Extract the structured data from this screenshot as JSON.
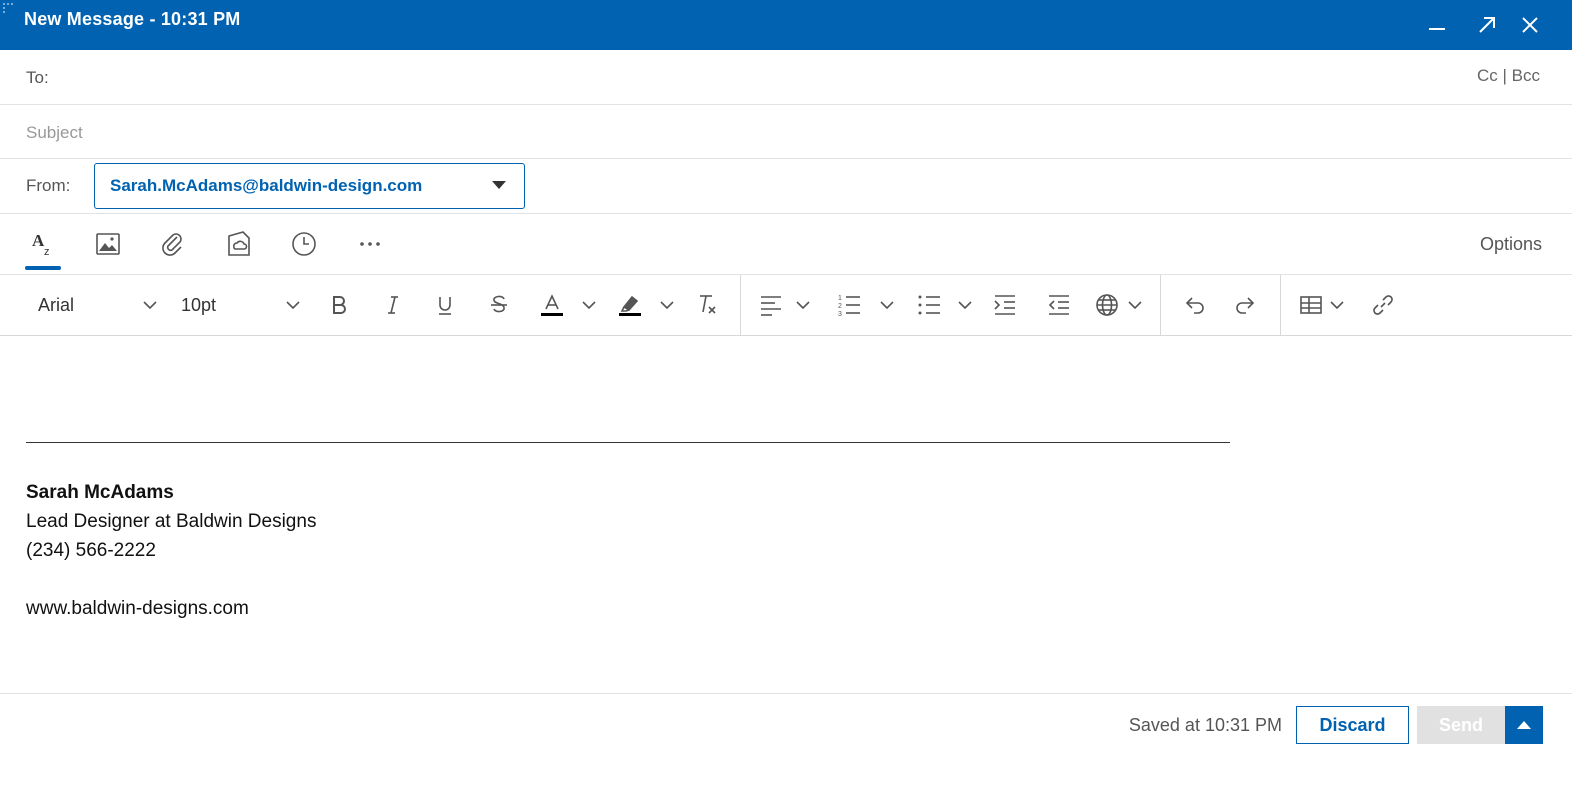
{
  "window": {
    "title": "New Message - 10:31 PM",
    "colors": {
      "titlebar": "#0062b1",
      "accent": "#0062b1"
    }
  },
  "to": {
    "label": "To:",
    "value": "",
    "cc_bcc": "Cc | Bcc"
  },
  "subject": {
    "placeholder": "Subject",
    "value": ""
  },
  "from": {
    "label": "From:",
    "value": "Sarah.McAdams@baldwin-design.com"
  },
  "compose_tabs": {
    "items": [
      "format-text-icon",
      "image-icon",
      "attachment-icon",
      "cloud-attachment-icon",
      "schedule-icon",
      "more-icon"
    ],
    "active": "format-text-icon",
    "options_label": "Options"
  },
  "format": {
    "font_family": "Arial",
    "font_size": "10pt"
  },
  "signature": {
    "name": "Sarah McAdams",
    "role": "Lead Designer at Baldwin Designs",
    "phone": "(234) 566-2222",
    "website": "www.baldwin-designs.com"
  },
  "footer": {
    "saved_status": "Saved at 10:31 PM",
    "discard_label": "Discard",
    "send_label": "Send"
  }
}
